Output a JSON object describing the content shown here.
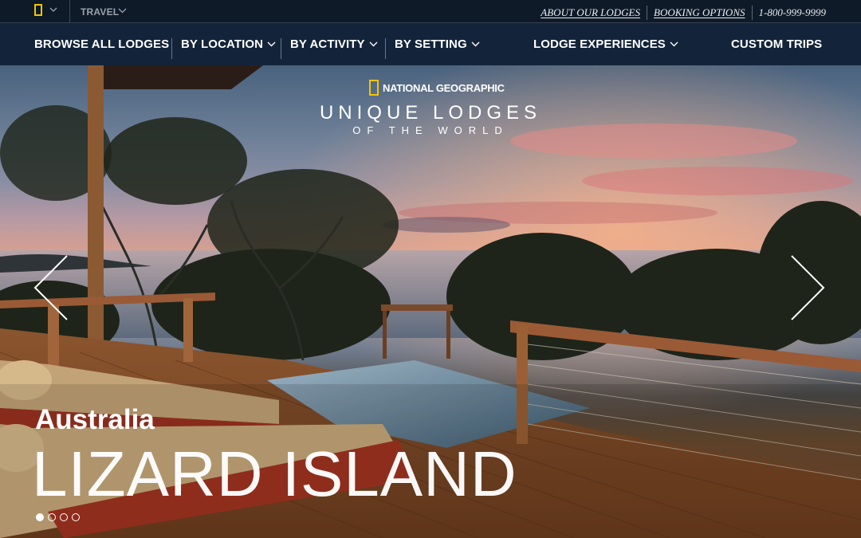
{
  "topbar": {
    "travel_label": "TRAVEL",
    "links": [
      "ABOUT OUR LODGES",
      "BOOKING OPTIONS"
    ],
    "phone": "1-800-999-9999"
  },
  "nav": {
    "items": [
      {
        "label": "BROWSE ALL LODGES",
        "dropdown": false
      },
      {
        "label": "BY LOCATION",
        "dropdown": true
      },
      {
        "label": "BY ACTIVITY",
        "dropdown": true
      },
      {
        "label": "BY SETTING",
        "dropdown": true
      },
      {
        "label": "LODGE EXPERIENCES",
        "dropdown": true
      },
      {
        "label": "CUSTOM TRIPS",
        "dropdown": false
      }
    ]
  },
  "hero": {
    "brand": "NATIONAL GEOGRAPHIC",
    "title": "UNIQUE LODGES",
    "subtitle": "OF THE WORLD",
    "country": "Australia",
    "lodge_name": "LIZARD ISLAND",
    "slides_total": 4,
    "active_slide": 1
  },
  "colors": {
    "brand_yellow": "#f5c400",
    "nav_bg": "#13243a",
    "topbar_bg": "#0e1a28"
  }
}
